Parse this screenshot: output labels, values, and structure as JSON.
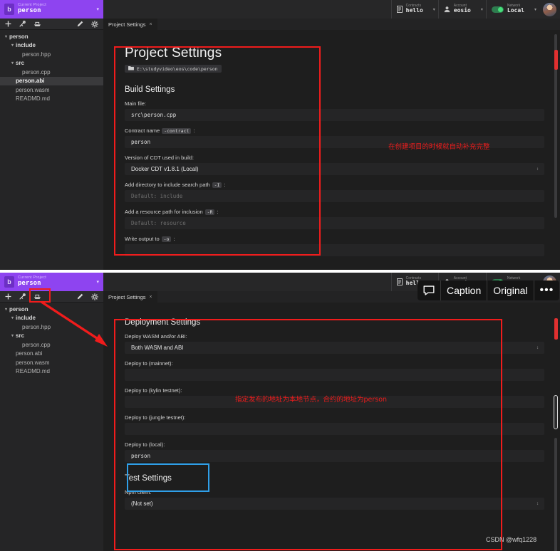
{
  "app": {
    "project_label": "Current Project",
    "project_name": "person",
    "project_caret": "▾",
    "toolbar_icons": [
      "add-icon",
      "wrench-icon",
      "deploy-boat-icon",
      "pencil-icon",
      "gear-icon"
    ],
    "tab_label": "Project Settings",
    "tab_close": "×"
  },
  "status": {
    "contracts": {
      "label": "Contracts",
      "value": "hello",
      "icon": "contract-icon",
      "caret": "▾"
    },
    "account": {
      "label": "Account",
      "value": "eosio",
      "icon": "person-icon",
      "caret": "▾"
    },
    "network": {
      "label": "Network",
      "value": "Local",
      "icon": "toggle-on-icon",
      "caret": "▾"
    },
    "avatar": "avatar"
  },
  "tree": {
    "items": [
      {
        "label": "person",
        "depth": 0,
        "twisty": "▾",
        "bold": true,
        "selected": false
      },
      {
        "label": "include",
        "depth": 1,
        "twisty": "▾",
        "bold": true,
        "selected": false
      },
      {
        "label": "person.hpp",
        "depth": 2,
        "twisty": "",
        "bold": false,
        "selected": false
      },
      {
        "label": "src",
        "depth": 1,
        "twisty": "▾",
        "bold": true,
        "selected": false
      },
      {
        "label": "person.cpp",
        "depth": 2,
        "twisty": "",
        "bold": false,
        "selected": false
      },
      {
        "label": "person.abi",
        "depth": 1,
        "twisty": "",
        "bold": true,
        "selected": true
      },
      {
        "label": "person.wasm",
        "depth": 1,
        "twisty": "",
        "bold": false,
        "selected": false
      },
      {
        "label": "READMD.md",
        "depth": 1,
        "twisty": "",
        "bold": false,
        "selected": false
      }
    ],
    "items_bottom": [
      {
        "label": "person",
        "depth": 0,
        "twisty": "▾",
        "bold": true,
        "selected": false
      },
      {
        "label": "include",
        "depth": 1,
        "twisty": "▾",
        "bold": true,
        "selected": false
      },
      {
        "label": "person.hpp",
        "depth": 2,
        "twisty": "",
        "bold": false,
        "selected": false
      },
      {
        "label": "src",
        "depth": 1,
        "twisty": "▾",
        "bold": true,
        "selected": false
      },
      {
        "label": "person.cpp",
        "depth": 2,
        "twisty": "",
        "bold": false,
        "selected": false
      },
      {
        "label": "person.abi",
        "depth": 1,
        "twisty": "",
        "bold": false,
        "selected": false
      },
      {
        "label": "person.wasm",
        "depth": 1,
        "twisty": "",
        "bold": false,
        "selected": false
      },
      {
        "label": "READMD.md",
        "depth": 1,
        "twisty": "",
        "bold": false,
        "selected": false
      }
    ]
  },
  "top_pane": {
    "title": "Project Settings",
    "path": "E:\\studyvideo\\eos\\code\\person",
    "path_icon": "folder-icon",
    "section": "Build Settings",
    "fields": [
      {
        "label": "Main file:",
        "flag": "",
        "value": "src\\person.cpp",
        "placeholder": "",
        "kind": "text"
      },
      {
        "label": "Contract name",
        "flag": "-contract",
        "suffix": ":",
        "value": "person",
        "placeholder": "",
        "kind": "text"
      },
      {
        "label": "Version of CDT used in build:",
        "flag": "",
        "value": "Docker CDT v1.8.1 (Local)",
        "placeholder": "",
        "kind": "select"
      },
      {
        "label": "Add directory to include search path",
        "flag": "-I",
        "suffix": ":",
        "value": "",
        "placeholder": "Default: include",
        "kind": "text"
      },
      {
        "label": "Add a resource path for inclusion",
        "flag": "-R",
        "suffix": ":",
        "value": "",
        "placeholder": "Default: resource",
        "kind": "text"
      },
      {
        "label": "Write output to",
        "flag": "-o",
        "suffix": ":",
        "value": "",
        "placeholder": "",
        "kind": "text"
      }
    ],
    "annotation": "在创建项目的时候就自动补充完整"
  },
  "bottom_pane": {
    "section_deploy": "Deployment Settings",
    "fields": [
      {
        "label": "Deploy WASM and/or ABI:",
        "value": "Both WASM and ABI",
        "placeholder": "",
        "kind": "select"
      },
      {
        "label": "Deploy to (mainnet):",
        "value": "",
        "placeholder": "",
        "kind": "text"
      },
      {
        "label": "Deploy to (kylin testnet):",
        "value": "",
        "placeholder": "",
        "kind": "text"
      },
      {
        "label": "Deploy to (jungle testnet):",
        "value": "",
        "placeholder": "",
        "kind": "text"
      },
      {
        "label": "Deploy to (local):",
        "value": "person",
        "placeholder": "",
        "kind": "text",
        "highlighted": true
      }
    ],
    "section_test": "Test Settings",
    "test_fields": [
      {
        "label": "Npm client:",
        "value": "(Not set)",
        "placeholder": "",
        "kind": "select"
      }
    ],
    "annotation": "指定发布的地址为本地节点，合约的地址为person"
  },
  "caption_bar": {
    "bubble_icon": "speech-bubble-icon",
    "caption_label": "Caption",
    "original_label": "Original",
    "more_label": "•••"
  },
  "watermark": "CSDN @wfq1228",
  "colors": {
    "accent_purple": "#8e44f0",
    "annotation_red": "#f01c1c",
    "highlight_blue": "#2f9fe8",
    "network_green": "#46e07a",
    "panel_bg": "#1e1e1e",
    "field_bg": "#252526"
  }
}
